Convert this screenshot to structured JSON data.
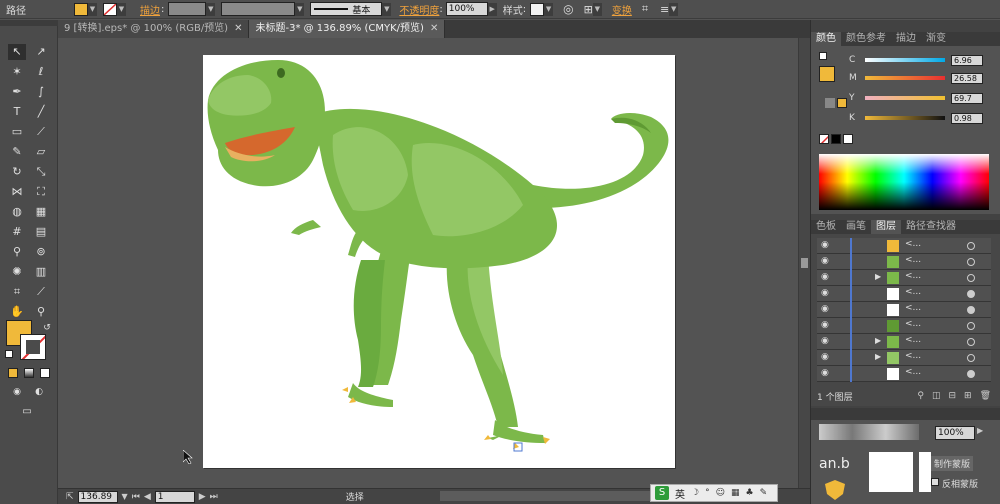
{
  "control_bar": {
    "object_type": "路径",
    "fill_color": "#f0b93a",
    "stroke_label": "描边",
    "stroke_profile": "基本",
    "opacity_label": "不透明度",
    "opacity_value": "100%",
    "style_label": "样式",
    "transform_label": "变换"
  },
  "tabs": [
    {
      "label": "9 [转换].eps* @ 100% (RGB/预览)"
    },
    {
      "label": "未标题-3* @ 136.89% (CMYK/预览)"
    }
  ],
  "status": {
    "zoom": "136.89",
    "page": "1",
    "tool": "选择"
  },
  "color_panel": {
    "tabs": [
      "颜色",
      "颜色参考",
      "描边",
      "渐变"
    ],
    "fill": "#f0b93a",
    "channels": [
      {
        "name": "C",
        "value": "6.96"
      },
      {
        "name": "M",
        "value": "26.58"
      },
      {
        "name": "Y",
        "value": "69.7"
      },
      {
        "name": "K",
        "value": "0.98"
      }
    ]
  },
  "layers_panel": {
    "tabs": [
      "色板",
      "画笔",
      "图层",
      "路径查找器"
    ],
    "rows": [
      "<...",
      "<...",
      "<...",
      "<...",
      "<...",
      "<...",
      "<...",
      "<...",
      "<..."
    ],
    "count": "1 个图层"
  },
  "bottom_panel": {
    "opacity_value": "100%",
    "text_1": "an.b",
    "text_2": "制作蒙版",
    "text_3": "反相蒙版"
  },
  "ime": "英",
  "colors": {
    "dino_body": "#7cb84a",
    "dino_light": "#93c765",
    "dino_dark": "#5f9a33",
    "claw": "#f0b93a",
    "mouth": "#d5682d",
    "ui_accent": "#f0a23c"
  }
}
